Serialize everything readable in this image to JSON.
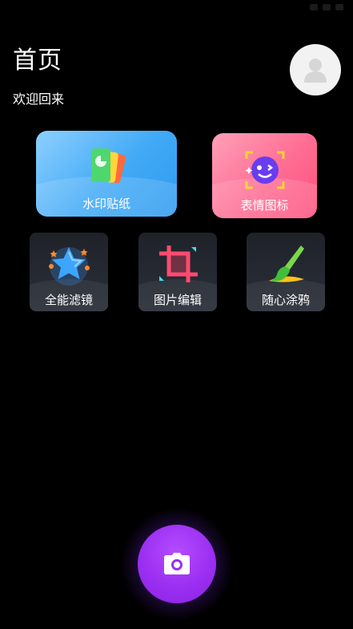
{
  "header": {
    "title": "首页",
    "welcome": "欢迎回来"
  },
  "features_top": [
    {
      "label": "水印贴纸",
      "icon": "sticker-cards-icon"
    },
    {
      "label": "表情图标",
      "icon": "emoji-face-icon"
    }
  ],
  "features_bottom": [
    {
      "label": "全能滤镜",
      "icon": "star-filter-icon"
    },
    {
      "label": "图片编辑",
      "icon": "crop-icon"
    },
    {
      "label": "随心涂鸦",
      "icon": "brush-icon"
    }
  ],
  "camera": {
    "icon": "camera-icon"
  },
  "colors": {
    "background": "#000000",
    "watermark_card": "#42aaf6",
    "emoji_card": "#ff6d93",
    "small_card": "#262a33",
    "camera_button": "#9b2ff2"
  }
}
